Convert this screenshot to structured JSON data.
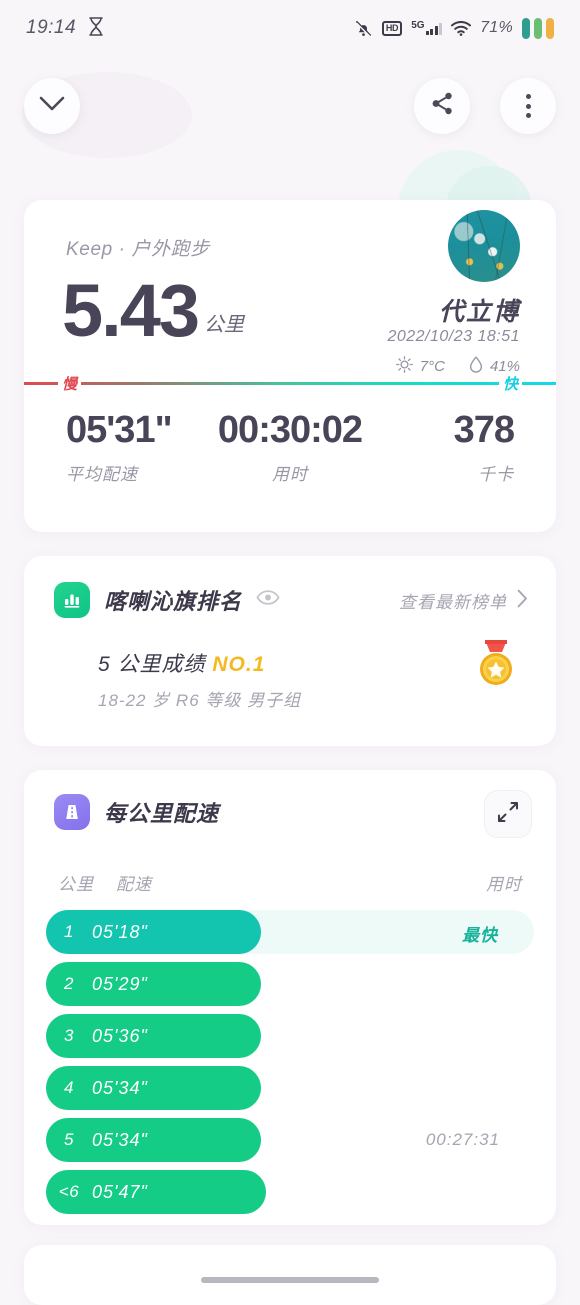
{
  "status_bar": {
    "time": "19:14",
    "hourglass_icon": "hourglass-icon",
    "mute_icon": "bell-off-icon",
    "hd_label": "HD",
    "network_label": "5G",
    "wifi_icon": "wifi-icon",
    "battery_percent": "71%",
    "battery_bar_colors": [
      "#2f9e8f",
      "#6bbf73",
      "#efb044"
    ]
  },
  "topnav": {
    "collapse_icon": "chevron-down-icon",
    "share_icon": "share-icon",
    "more_icon": "more-vertical-icon"
  },
  "summary": {
    "sport_label": "Keep · 户外跑步",
    "distance_value": "5.43",
    "distance_unit": "公里",
    "user_name": "代立博",
    "datetime": "2022/10/23 18:51",
    "weather": {
      "sun_icon": "sun-icon",
      "temperature": "7°C",
      "humidity_icon": "water-drop-icon",
      "humidity": "41%"
    },
    "gradient": {
      "slow_label": "慢",
      "fast_label": "快",
      "slow_color": "#e2484f",
      "fast_color": "#13cfe2"
    },
    "stats": [
      {
        "value": "05'31\"",
        "label": "平均配速"
      },
      {
        "value": "00:30:02",
        "label": "用时"
      },
      {
        "value": "378",
        "label": "千卡"
      }
    ]
  },
  "rank_card": {
    "icon": "bar-chart-icon",
    "title": "喀喇沁旗排名",
    "visibility_icon": "eye-icon",
    "link_text": "查看最新榜单",
    "chevron_icon": "chevron-right-icon",
    "result_prefix": "5 公里成绩 ",
    "result_rank": "NO.1",
    "subtitle": "18-22 岁 R6 等级 男子组",
    "medal_icon": "gold-medal-icon"
  },
  "pace_card": {
    "icon": "road-icon",
    "title": "每公里配速",
    "expand_icon": "expand-icon",
    "columns": {
      "km": "公里",
      "pace": "配速",
      "time": "用时"
    },
    "fastest_badge": "最快",
    "rows": [
      {
        "km": "1",
        "pace": "05'18\"",
        "badge": "最快",
        "time": "",
        "fastest": true
      },
      {
        "km": "2",
        "pace": "05'29\"",
        "badge": "",
        "time": "",
        "fastest": false
      },
      {
        "km": "3",
        "pace": "05'36\"",
        "badge": "",
        "time": "",
        "fastest": false
      },
      {
        "km": "4",
        "pace": "05'34\"",
        "badge": "",
        "time": "",
        "fastest": false
      },
      {
        "km": "5",
        "pace": "05'34\"",
        "badge": "",
        "time": "00:27:31",
        "fastest": false
      },
      {
        "km": "<6",
        "pace": "05'47\"",
        "badge": "",
        "time": "",
        "fastest": false
      }
    ],
    "bar_color_fastest": "#13c4ae",
    "bar_color_normal": "#14cc86",
    "track_color": "#eefaf8"
  },
  "chart_data": {
    "type": "bar",
    "title": "每公里配速",
    "categories": [
      "1",
      "2",
      "3",
      "4",
      "5",
      "<6"
    ],
    "values": [
      "05'18\"",
      "05'29\"",
      "05'36\"",
      "05'34\"",
      "05'34\"",
      "05'47\""
    ],
    "value_seconds": [
      318,
      329,
      336,
      334,
      334,
      347
    ],
    "bar_widths_pct": [
      74,
      74,
      74,
      74,
      74,
      76
    ],
    "xlabel": "公里",
    "ylabel": "配速",
    "annotations": [
      "最快",
      "00:27:31"
    ],
    "grid": false,
    "legend": "none"
  }
}
